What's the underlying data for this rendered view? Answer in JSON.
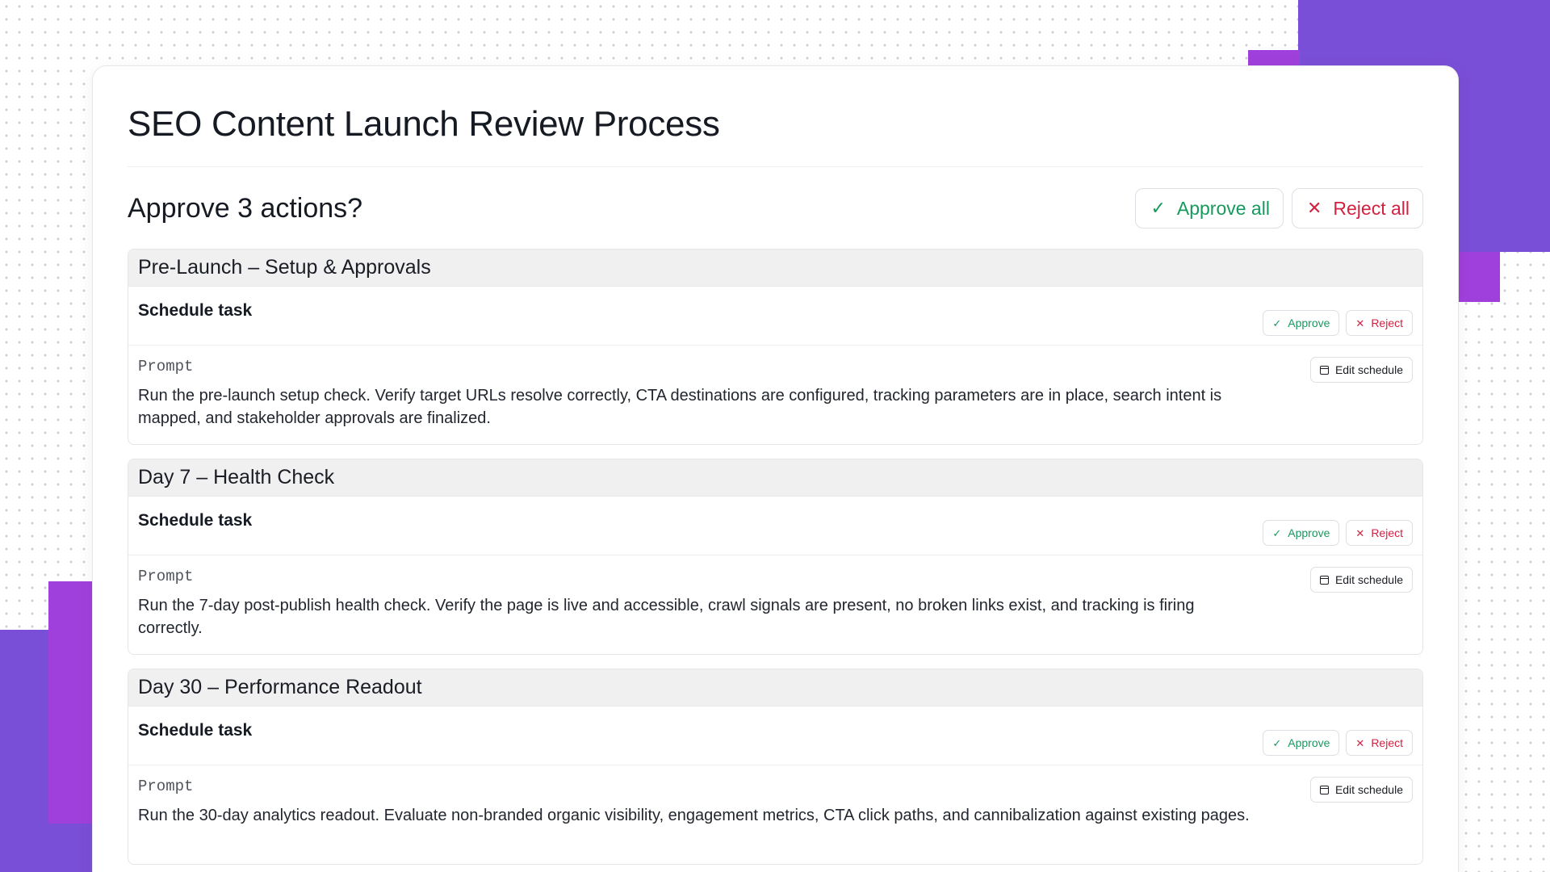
{
  "page": {
    "title": "SEO Content Launch Review Process",
    "approve_heading": "Approve 3 actions?",
    "approve_all_label": "Approve all",
    "reject_all_label": "Reject all"
  },
  "icons": {
    "approve": "check-icon",
    "reject": "x-icon",
    "edit_schedule": "calendar-icon"
  },
  "colors": {
    "approve": "#169a5c",
    "reject": "#d22141",
    "accent_purple": "#7a4fd8",
    "accent_magenta": "#a040dc"
  },
  "sections": [
    {
      "title": "Pre-Launch – Setup & Approvals",
      "task_label": "Schedule task",
      "approve_label": "Approve",
      "reject_label": "Reject",
      "prompt_label": "Prompt",
      "prompt_text": "Run the pre-launch setup check. Verify target URLs resolve correctly, CTA destinations are configured, tracking parameters are in place, search intent is mapped, and stakeholder approvals are finalized.",
      "edit_label": "Edit schedule"
    },
    {
      "title": "Day 7 – Health Check",
      "task_label": "Schedule task",
      "approve_label": "Approve",
      "reject_label": "Reject",
      "prompt_label": "Prompt",
      "prompt_text": "Run the 7-day post-publish health check. Verify the page is live and accessible, crawl signals are present, no broken links exist, and tracking is firing correctly.",
      "edit_label": "Edit schedule"
    },
    {
      "title": "Day 30 – Performance Readout",
      "task_label": "Schedule task",
      "approve_label": "Approve",
      "reject_label": "Reject",
      "prompt_label": "Prompt",
      "prompt_text": "Run the 30-day analytics readout. Evaluate non-branded organic visibility, engagement metrics, CTA click paths, and cannibalization against existing pages.",
      "edit_label": "Edit schedule"
    }
  ]
}
